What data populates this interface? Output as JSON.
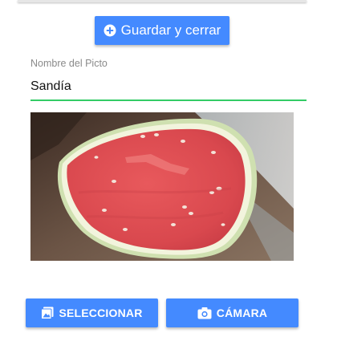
{
  "header": {
    "save_button_label": "Guardar y cerrar"
  },
  "form": {
    "name_label": "Nombre del Picto",
    "name_value": "Sandía"
  },
  "image": {
    "subject": "watermelon slice"
  },
  "actions": {
    "select_label": "SELECCIONAR",
    "camera_label": "CÁMARA"
  },
  "colors": {
    "button": "#448aff",
    "input_underline": "#33cc66",
    "label": "#8a8a8a"
  },
  "icons": {
    "save": "plus-circle-icon",
    "select": "image-gallery-icon",
    "camera": "camera-icon"
  }
}
